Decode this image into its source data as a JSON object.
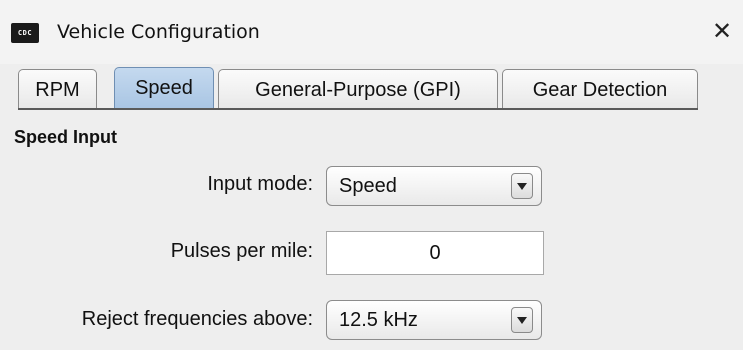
{
  "window": {
    "icon_text": "CDC",
    "title": "Vehicle Configuration",
    "close_glyph": "✕"
  },
  "tabs": [
    {
      "label": "RPM",
      "selected": false
    },
    {
      "label": "Speed",
      "selected": true
    },
    {
      "label": "General-Purpose (GPI)",
      "selected": false
    },
    {
      "label": "Gear Detection",
      "selected": false
    }
  ],
  "section": {
    "title": "Speed Input"
  },
  "form": {
    "input_mode": {
      "label": "Input mode:",
      "value": "Speed"
    },
    "pulses_per_mile": {
      "label": "Pulses per mile:",
      "value": "0"
    },
    "reject_frequencies": {
      "label": "Reject frequencies above:",
      "value": "12.5 kHz"
    }
  },
  "colors": {
    "selected_tab": "#b4cde8",
    "window_bg": "#f0f0f0"
  }
}
